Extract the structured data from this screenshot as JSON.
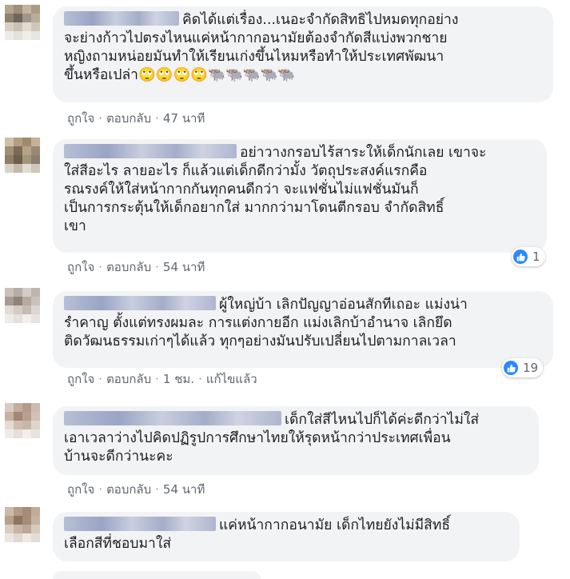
{
  "comments": [
    {
      "text_lines": [
        "คิดได้แต่เรื่อง...เนอะจำกัดสิทธิไปหมดทุกอย่าง",
        "จะย่างก้าวไปตรงไหนแค่หน้ากากอนามัยต้องจำกัดสีแบ่งพวกชาย",
        "หญิงถามหน่อยมันทำให้เรียนเก่งขึ้นไหมหรือทำให้ประเทศพัฒนา",
        "ขึ้นหรือเปล่า🙄🙄🙄🙄🐃🐃🐃🐃🐃"
      ],
      "like_label": "ถูกใจ",
      "reply_label": "ตอบกลับ",
      "time": "47 นาที"
    },
    {
      "text_lines": [
        "อย่าวางกรอบไร้สาระให้เด็กนักเลย เขาจะ",
        "ใส่สีอะไร ลายอะไร ก็แล้วแต่เด็กดีกว่ามั้ง วัตถุประสงค์แรกคือ",
        "รณรงค์ให้ใส่หน้ากากกันทุกคนดีกว่า จะแฟชั่นไม่แฟชั่นมันก็",
        "เป็นการกระตุ้นให้เด็กอยากใส่ มากกว่ามาโดนตีกรอบ จำกัดสิทธิ์",
        "เขา"
      ],
      "like_label": "ถูกใจ",
      "reply_label": "ตอบกลับ",
      "time": "54 นาที",
      "reaction_count": "1"
    },
    {
      "text_lines": [
        "ผู้ใหญ่บ้า เลิกปัญญาอ่อนสักทีเถอะ แม่งน่า",
        "รำคาญ ตั้งแต่ทรงผมละ การแต่งกายอีก แม่งเลิกบ้าอำนาจ เลิกยึด",
        "ติดวัฒนธรรมเก่าๆได้แล้ว ทุกๆอย่างมันปรับเปลี่ยนไปตามกาลเวลา"
      ],
      "like_label": "ถูกใจ",
      "reply_label": "ตอบกลับ",
      "time": "1 ชม.",
      "edited_label": "แก้ไขแล้ว",
      "reaction_count": "19"
    },
    {
      "text_lines": [
        "เด็กใส่สีไหนไปก็ได้ค่ะดีกว่าไม่ใส่",
        "เอาเวลาว่างไปคิดปฏิรูปการศึกษาไทยให้รุดหน้ากว่าประเทศเพื่อน",
        "บ้านจะดีกว่านะคะ"
      ],
      "like_label": "ถูกใจ",
      "reply_label": "ตอบกลับ",
      "time": "54 นาที"
    },
    {
      "text_lines": [
        "แค่หน้ากากอนามัย เด็กไทยยังไม่มีสิทธิ์",
        "เลือกสีที่ชอบมาใส่"
      ]
    }
  ],
  "icons": {
    "like_reaction": "thumbs-up-icon"
  },
  "colors": {
    "bubble_bg": "#f2f3f5",
    "meta_text": "#606770",
    "like_blue": "#2d88ff"
  }
}
